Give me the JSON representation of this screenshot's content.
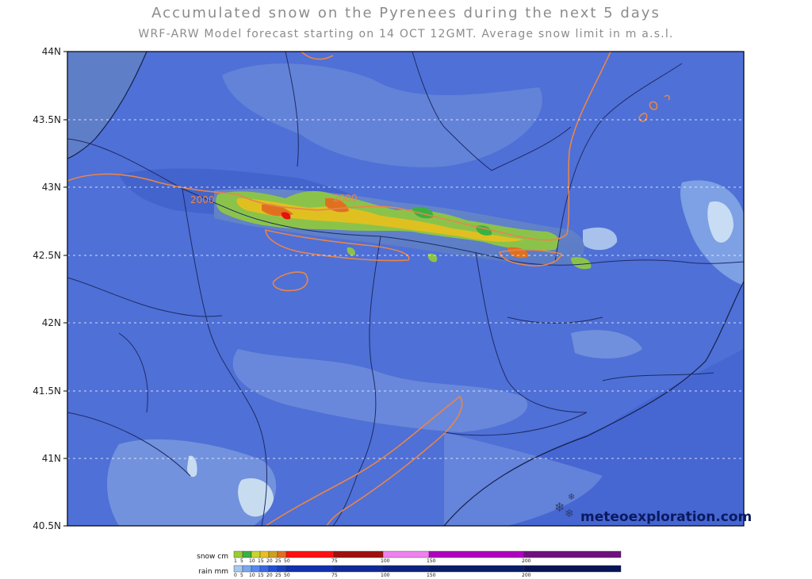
{
  "title": "Accumulated snow on the Pyrenees during the next 5 days",
  "subtitle": "WRF-ARW Model forecast starting on 14 OCT 12GMT.  Average snow limit in m a.s.l.",
  "lat_labels": [
    "44N",
    "43.5N",
    "43N",
    "42.5N",
    "42N",
    "41.5N",
    "41N",
    "40.5N"
  ],
  "contour_labels": [
    "2000",
    "2000"
  ],
  "legend": {
    "snow_label": "snow cm",
    "rain_label": "rain mm",
    "snow_ticks": [
      "1",
      "5",
      "10",
      "15",
      "20",
      "25",
      "50",
      "75",
      "100",
      "150",
      "200"
    ],
    "rain_ticks": [
      "0",
      "5",
      "10",
      "15",
      "20",
      "25",
      "50",
      "75",
      "100",
      "150",
      "200"
    ],
    "snow_colors": [
      "#9acd32",
      "#3cb043",
      "#c8d62c",
      "#e8c020",
      "#d0a020",
      "#e07020",
      "#ff1010",
      "#a01010",
      "#ee82ee",
      "#b000c0",
      "#701080"
    ],
    "rain_colors": [
      "#a8c8f0",
      "#78a8f0",
      "#5888f0",
      "#3868e8",
      "#2050d8",
      "#1840c0",
      "#1030b0",
      "#0e2a98",
      "#0b2280",
      "#081c6a",
      "#061458"
    ]
  },
  "brand": "meteoexploration.com",
  "brand_icon": "snowflake-icon"
}
